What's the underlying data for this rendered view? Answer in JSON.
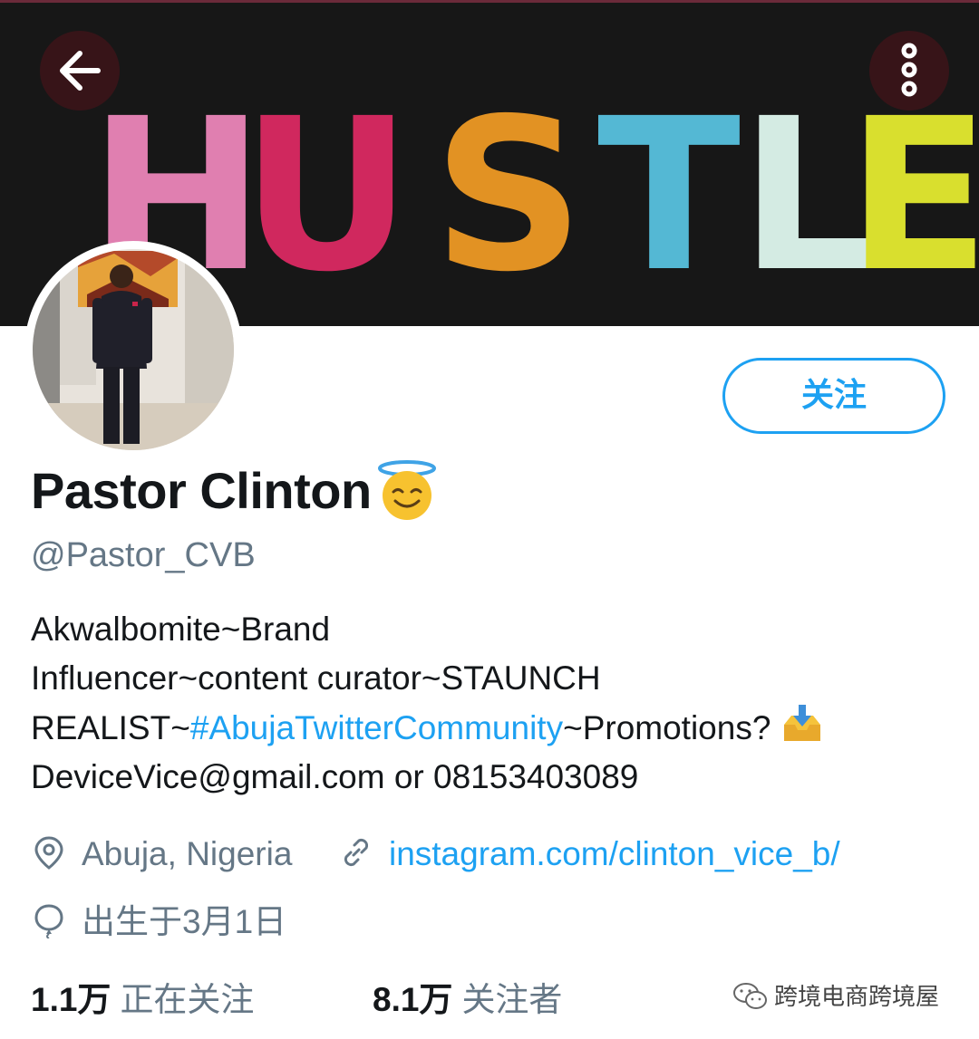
{
  "banner": {
    "word_letters": [
      "H",
      "U",
      "S",
      "T",
      "L",
      "E"
    ],
    "letter_colors": [
      "#e07fb0",
      "#d0285e",
      "#e29223",
      "#54b8d4",
      "#d4ebe3",
      "#d9df2e"
    ],
    "background": "#171717"
  },
  "toolbar": {
    "back_icon": "arrow-left-icon",
    "more_icon": "more-vertical-icon"
  },
  "profile": {
    "follow_label": "关注",
    "name": "Pastor Clinton",
    "name_emoji": "smiling-face-with-halo",
    "handle": "@Pastor_CVB",
    "bio": {
      "line1": "Akwalbomite~Brand",
      "line2": "Influencer~content curator~STAUNCH",
      "line3_prefix": "REALIST~",
      "line3_hashtag": "#AbujaTwitterCommunity",
      "line3_suffix": "~Promotions? ",
      "line3_icon": "inbox-tray-emoji",
      "line4": "DeviceVice@gmail.com or 08153403089"
    },
    "location": "Abuja, Nigeria",
    "website": "instagram.com/clinton_vice_b/",
    "birthday": "出生于3月1日"
  },
  "stats": {
    "following_count": "1.1万",
    "following_label": "正在关注",
    "followers_count": "8.1万",
    "followers_label": "关注者"
  },
  "watermark": {
    "text": "跨境电商跨境屋",
    "icon": "wechat-icon"
  },
  "colors": {
    "accent": "#1da1f2",
    "secondary_text": "#657786",
    "primary_text": "#14171a"
  }
}
